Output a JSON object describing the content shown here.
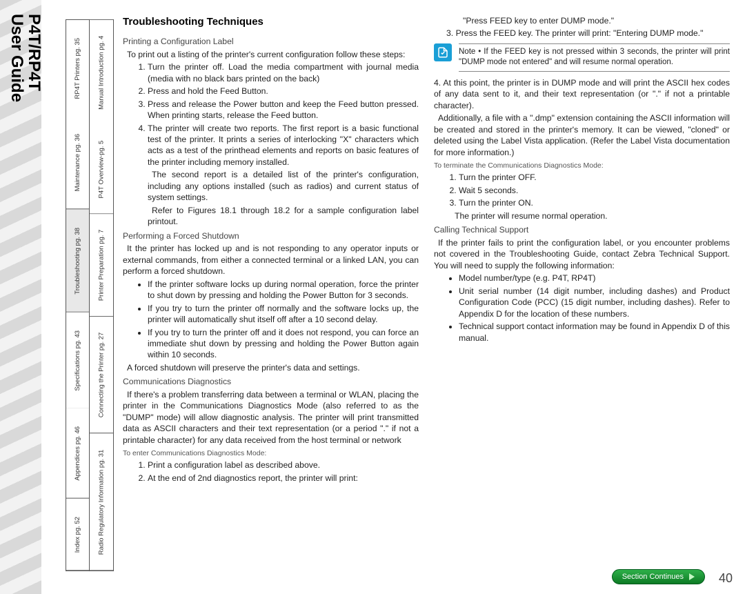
{
  "spine": {
    "line1": "P4T/RP4T",
    "line2": "User Guide"
  },
  "nav": {
    "row1": [
      {
        "label": "RP4T Printers pg. 35"
      },
      {
        "label": "Maintenance pg. 36"
      },
      {
        "label": "Troubleshooting pg. 38",
        "active": true
      },
      {
        "label": "Specifications pg. 43"
      },
      {
        "label": "Appendices pg. 46"
      },
      {
        "label": "Index pg. 52"
      }
    ],
    "row2": [
      {
        "label": "Manual Introduction pg. 4"
      },
      {
        "label": "P4T Overview-pg. 5"
      },
      {
        "label": "Printer Preparation pg. 7"
      },
      {
        "label": "Connecting the Printer pg. 27"
      },
      {
        "label": "Radio Regulatory Information pg. 31"
      }
    ]
  },
  "page": {
    "heading": "Troubleshooting Techniques",
    "sub1": "Printing a Configuration Label",
    "intro1": "To print out a listing of the printer's current configuration follow these steps:",
    "steps1": [
      "Turn the printer off.  Load the media compartment with journal media (media with no black bars printed on the back)",
      "Press and hold the Feed Button.",
      "Press and release the Power button and keep the Feed button pressed.  When printing starts, release the Feed button.",
      "The printer will create two reports.  The first report is a basic functional test of the printer.  It prints a series of interlocking \"X\" characters which acts as a test of the printhead elements and reports on basic features of the printer including memory installed."
    ],
    "steps1_tail1": "The second report is a detailed list of the printer's configuration, including any options installed (such as radios) and current status of system settings.",
    "steps1_tail2": "Refer to Figures 18.1 through 18.2 for a sample configuration label printout.",
    "sub2": "Performing a Forced Shutdown",
    "para2": "It the printer has locked up and is not responding to any operator inputs or external commands, from either a connected terminal or a linked LAN, you can perform a forced shutdown.",
    "bullets2": [
      "If the printer software locks up during normal operation, force the printer to shut down by pressing and holding the Power Button for 3 seconds.",
      "If you try to turn the printer off normally and the software locks up, the printer will automatically shut itself off after a 10 second delay.",
      "If you try to turn the printer off and it does not respond, you can force an immediate shut down by pressing and holding the Power Button again within 10 seconds."
    ],
    "para2_tail": "A forced shutdown will preserve the printer's data and settings.",
    "sub3": "Communications Diagnostics",
    "para3": "If there's a problem transferring data between a terminal or WLAN, placing the printer in the Communications Diagnostics Mode (also referred to as the \"DUMP\" mode) will allow diagnostic analysis. The printer will print transmitted data as ASCII characters and their text representation (or a period \".\" if not a printable character) for any data received from the host terminal or network",
    "small1": "To enter Communications Diagnostics Mode:",
    "steps3": [
      "Print a configuration label as described above.",
      "At the end of 2nd diagnostics report, the printer will print:"
    ],
    "col2_top1": "\"Press FEED key to enter DUMP mode.\"",
    "col2_top2": "Press the FEED key. The printer will print: \"Entering DUMP mode.\"",
    "note": "Note • If the FEED key is not pressed within 3 seconds, the printer will print \"DUMP mode not entered\" and will resume normal operation.",
    "col2_step4": "4. At this point, the printer is in DUMP mode and will print the ASCII hex codes of any data sent to it, and their text representation (or \".\" if not a printable character).",
    "col2_para2": "Additionally, a file with a \".dmp\" extension containing the ASCII information will be created and stored in the printer's memory. It can be viewed, \"cloned\" or deleted using the Label Vista application. (Refer the Label Vista documentation for more information.)",
    "small2": "To terminate the Communications Diagnostics Mode:",
    "steps4": [
      "Turn the printer OFF.",
      "Wait 5 seconds.",
      "Turn the printer ON."
    ],
    "steps4_tail": "The printer will resume normal operation.",
    "sub4": "Calling Technical Support",
    "para4": "If the printer fails to print the configuration label, or you encounter problems not covered in the Troubleshooting Guide, contact Zebra Technical Support.  You will need to supply the following information:",
    "bullets4": [
      "Model number/type (e.g. P4T, RP4T)",
      "Unit serial number (14 digit number, including dashes) and Product Configuration Code (PCC) (15 digit number, including dashes).  Refer to Appendix D for the location of these numbers.",
      "Technical support contact information may be found in Appendix D of this manual."
    ]
  },
  "footer": {
    "badge": "Section Continues",
    "page_num": "40"
  }
}
